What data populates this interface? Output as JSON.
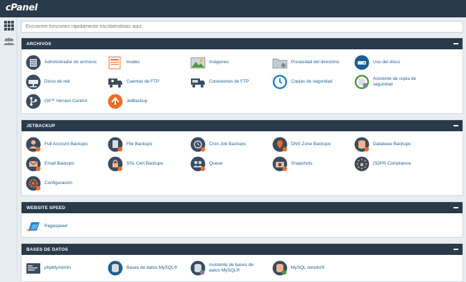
{
  "app": {
    "logo": "cPanel"
  },
  "search": {
    "placeholder": "Encuentre funciones rápidamente escribiéndolas aquí."
  },
  "sections": {
    "archivos": {
      "title": "ARCHIVOS",
      "items": [
        {
          "label": "Administrador de archivos",
          "icon": "file-manager-icon"
        },
        {
          "label": "Inodes",
          "icon": "inodes-icon"
        },
        {
          "label": "Imágenes",
          "icon": "images-icon"
        },
        {
          "label": "Privacidad del directorio",
          "icon": "directory-privacy-icon"
        },
        {
          "label": "Uso del disco",
          "icon": "disk-usage-icon"
        },
        {
          "label": "Disco de red",
          "icon": "network-disk-icon"
        },
        {
          "label": "Cuentas de FTP",
          "icon": "ftp-accounts-icon"
        },
        {
          "label": "Conexiones de FTP",
          "icon": "ftp-connections-icon"
        },
        {
          "label": "Copias de seguridad",
          "icon": "backup-icon"
        },
        {
          "label": "Asistente de copia de seguridad",
          "icon": "backup-wizard-icon"
        },
        {
          "label": "Git™ Version Control",
          "icon": "git-icon"
        },
        {
          "label": "JetBackup",
          "icon": "jetbackup-icon"
        }
      ]
    },
    "jetbackup": {
      "title": "JETBACKUP",
      "items": [
        {
          "label": "Full Account Backups",
          "icon": "full-account-backup-icon"
        },
        {
          "label": "File Backups",
          "icon": "file-backup-icon"
        },
        {
          "label": "Cron Job Backups",
          "icon": "cron-backup-icon"
        },
        {
          "label": "DNS Zone Backups",
          "icon": "dns-backup-icon"
        },
        {
          "label": "Database Backups",
          "icon": "database-backup-icon"
        },
        {
          "label": "Email Backups",
          "icon": "email-backup-icon"
        },
        {
          "label": "SSL Cert Backups",
          "icon": "ssl-backup-icon"
        },
        {
          "label": "Queue",
          "icon": "queue-icon"
        },
        {
          "label": "Snapshots",
          "icon": "snapshots-icon"
        },
        {
          "label": "GDPR Compliance",
          "icon": "gdpr-icon"
        },
        {
          "label": "Configuración",
          "icon": "settings-icon"
        }
      ]
    },
    "website_speed": {
      "title": "WEBSITE SPEED",
      "items": [
        {
          "label": "Pagespeed",
          "icon": "pagespeed-icon"
        }
      ]
    },
    "bases_de_datos": {
      "title": "BASES DE DATOS",
      "items": [
        {
          "label": "phpMyAdmin",
          "icon": "phpmyadmin-icon"
        },
        {
          "label": "Bases de datos MySQL®",
          "icon": "mysql-databases-icon"
        },
        {
          "label": "Asistente de bases de datos MySQL®",
          "icon": "mysql-wizard-icon"
        },
        {
          "label": "MySQL remoto®",
          "icon": "remote-mysql-icon"
        }
      ]
    }
  },
  "colors": {
    "header": "#293a4a",
    "link": "#1d5f92",
    "background": "#e8edf1",
    "accent": "#f26b21"
  }
}
